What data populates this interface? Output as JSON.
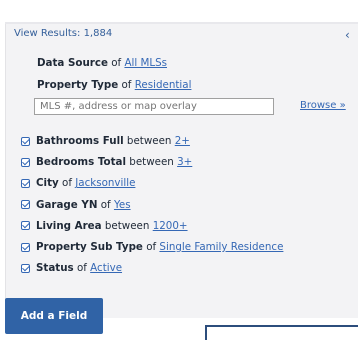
{
  "header": {
    "view_results": "View Results: 1,884",
    "collapse_icon": "chevron-left-icon",
    "collapse_glyph": "‹"
  },
  "fields": {
    "data_source": {
      "name": "Data Source",
      "connector": "of",
      "value": "All MLSs"
    },
    "property_type": {
      "name": "Property Type",
      "connector": "of",
      "value": "Residential"
    }
  },
  "search": {
    "placeholder": "MLS #, address or map overlay",
    "browse_label": "Browse »"
  },
  "criteria": [
    {
      "name": "Bathrooms Full",
      "connector": "between",
      "value": "2+",
      "checked": true
    },
    {
      "name": "Bedrooms Total",
      "connector": "between",
      "value": "3+",
      "checked": true
    },
    {
      "name": "City",
      "connector": "of",
      "value": "Jacksonville",
      "checked": true
    },
    {
      "name": "Garage YN",
      "connector": "of",
      "value": "Yes",
      "checked": true
    },
    {
      "name": "Living Area",
      "connector": "between",
      "value": "1200+",
      "checked": true
    },
    {
      "name": "Property Sub Type",
      "connector": "of",
      "value": "Single Family Residence",
      "checked": true
    },
    {
      "name": "Status",
      "connector": "of",
      "value": "Active",
      "checked": true
    }
  ],
  "actions": {
    "add_field": "Add a Field"
  },
  "colors": {
    "accent": "#3063a6",
    "link": "#3568b5",
    "panel_bg": "#f3f3f5"
  }
}
